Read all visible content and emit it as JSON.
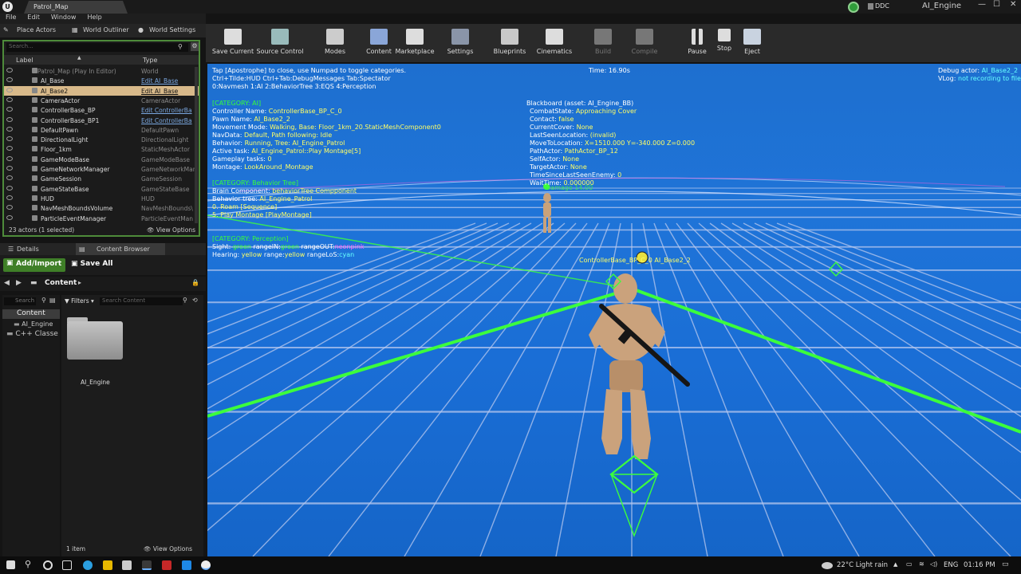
{
  "window": {
    "tab_title": "Patrol_Map",
    "project_name": "AI_Engine",
    "ddc_label": "DDC"
  },
  "menu": [
    "File",
    "Edit",
    "Window",
    "Help"
  ],
  "left_tabs": {
    "place_actors": "Place Actors",
    "world_outliner": "World Outliner",
    "world_settings": "World Settings"
  },
  "outliner": {
    "search_placeholder": "Search...",
    "col_label": "Label",
    "col_type": "Type",
    "rows": [
      {
        "label": "Patrol_Map (Play In Editor)",
        "type": "World",
        "link": false,
        "sel": false
      },
      {
        "label": "AI_Base",
        "type": "Edit AI_Base",
        "link": true,
        "sel": false
      },
      {
        "label": "AI_Base2",
        "type": "Edit AI_Base",
        "link": true,
        "sel": true
      },
      {
        "label": "CameraActor",
        "type": "CameraActor",
        "link": false,
        "sel": false
      },
      {
        "label": "ControllerBase_BP",
        "type": "Edit ControllerBa",
        "link": true,
        "sel": false
      },
      {
        "label": "ControllerBase_BP1",
        "type": "Edit ControllerBa",
        "link": true,
        "sel": false
      },
      {
        "label": "DefaultPawn",
        "type": "DefaultPawn",
        "link": false,
        "sel": false
      },
      {
        "label": "DirectionalLight",
        "type": "DirectionalLight",
        "link": false,
        "sel": false
      },
      {
        "label": "Floor_1km",
        "type": "StaticMeshActor",
        "link": false,
        "sel": false
      },
      {
        "label": "GameModeBase",
        "type": "GameModeBase",
        "link": false,
        "sel": false
      },
      {
        "label": "GameNetworkManager",
        "type": "GameNetworkMan",
        "link": false,
        "sel": false
      },
      {
        "label": "GameSession",
        "type": "GameSession",
        "link": false,
        "sel": false
      },
      {
        "label": "GameStateBase",
        "type": "GameStateBase",
        "link": false,
        "sel": false
      },
      {
        "label": "HUD",
        "type": "HUD",
        "link": false,
        "sel": false
      },
      {
        "label": "NavMeshBoundsVolume",
        "type": "NavMeshBounds\\",
        "link": false,
        "sel": false
      },
      {
        "label": "ParticleEventManager",
        "type": "ParticleEventMan",
        "link": false,
        "sel": false
      }
    ],
    "footer": "23 actors (1 selected)",
    "view_options": "View Options"
  },
  "content_browser": {
    "details_tab": "Details",
    "cb_tab": "Content Browser",
    "add_import": "Add/Import",
    "save_all": "Save All",
    "path": "Content",
    "search_placeholder": "Search",
    "filters": "Filters",
    "search_content": "Search Content",
    "tree": [
      "Content",
      "AI_Engine",
      "C++ Classe"
    ],
    "asset": "AI_Engine",
    "item_count": "1 item",
    "view_options": "View Options"
  },
  "toolbar": [
    {
      "label": "Save Current",
      "dim": false
    },
    {
      "label": "Source Control",
      "dim": false
    },
    {
      "label": "Modes",
      "dim": false
    },
    {
      "label": "Content",
      "dim": false
    },
    {
      "label": "Marketplace",
      "dim": false
    },
    {
      "label": "Settings",
      "dim": false
    },
    {
      "label": "Blueprints",
      "dim": false
    },
    {
      "label": "Cinematics",
      "dim": false
    },
    {
      "label": "Build",
      "dim": true
    },
    {
      "label": "Compile",
      "dim": true
    },
    {
      "label": "Pause",
      "dim": false
    },
    {
      "label": "Stop",
      "dim": false
    },
    {
      "label": "Eject",
      "dim": false
    }
  ],
  "debug": {
    "tap_line": "Tap [Apostrophe] to close, use Numpad to toggle categories.",
    "ctrl_line": "Ctrl+Tilde:HUD  Ctrl+Tab:DebugMessages  Tab:Spectator",
    "cat_line": "0:Navmesh  1:AI  2:BehaviorTree  3:EQS  4:Perception",
    "time": "Time: 16.90s",
    "debug_actor_label": "Debug actor: ",
    "debug_actor": "AI_Base2_2",
    "vlog_label": "VLog: ",
    "vlog": "not recording to file",
    "cat_ai": "[CATEGORY: AI]",
    "ai_lines": [
      [
        "Controller Name: ",
        "ControllerBase_BP_C_0"
      ],
      [
        "Pawn Name: ",
        "AI_Base2_2"
      ],
      [
        "Movement Mode: ",
        "Walking, Base: Floor_1km_20.StaticMeshComponent0"
      ],
      [
        "NavData: ",
        "Default, Path following: Idle"
      ],
      [
        "Behavior: ",
        "Running, Tree: AI_Engine_Patrol"
      ],
      [
        "Active task: ",
        "AI_Engine_Patrol::Play Montage[5]"
      ],
      [
        "Gameplay tasks: ",
        "0"
      ],
      [
        "Montage: ",
        "LookAround_Montage"
      ]
    ],
    "cat_bt": "[CATEGORY: Behavior Tree]",
    "bt_lines": [
      [
        "Brain Component: ",
        "behaviorTree Compponent"
      ],
      [
        "Behavior tree: ",
        "AI_Engine_Patrol"
      ],
      [
        "",
        "  0. Roam [Sequence]"
      ],
      [
        "",
        "  5. Play Montage [PlayMontage]"
      ]
    ],
    "cat_perc": "[CATEGORY: Perception]",
    "sight": [
      "Sight: ",
      "green",
      " rangeIN:",
      "green",
      "  rangeOUT:",
      "neonpink"
    ],
    "hearing": [
      "Hearing: ",
      "yellow",
      " range:",
      "yellow",
      "  rangeLoS:",
      "cyan"
    ],
    "bb_title": "Blackboard (asset: AI_Engine_BB)",
    "bb_lines": [
      [
        "CombatState: ",
        "Approaching Cover"
      ],
      [
        "Contact: ",
        "false"
      ],
      [
        "CurrentCover: ",
        "None"
      ],
      [
        "LastSeenLocation: ",
        "(invalid)"
      ],
      [
        "MoveToLocation: ",
        "X=1510.000 Y=-340.000 Z=0.000"
      ],
      [
        "PathActor: ",
        "PathActor_BP_12"
      ],
      [
        "SelfActor: ",
        "None"
      ],
      [
        "TargetActor: ",
        "None"
      ],
      [
        "TimeSinceLastSeenEnemy: ",
        "0"
      ],
      [
        "WaitTime: ",
        "0.000000"
      ]
    ],
    "far_overlay": "Damage 14.00",
    "char_label": "ControllerBase_BP_C_0  AI_Base2_2"
  },
  "taskbar": {
    "weather": "22°C  Light rain",
    "lang": "ENG",
    "time": "01:16 PM"
  }
}
